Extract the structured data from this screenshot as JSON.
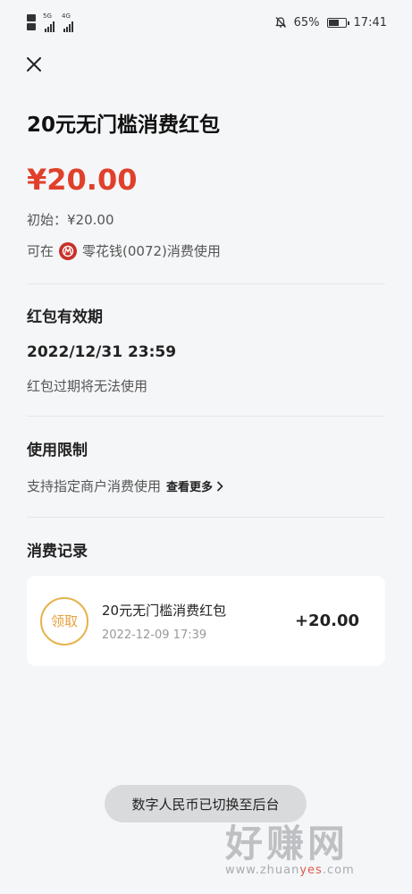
{
  "status_bar": {
    "sim1_type": "HD",
    "sim2_type": "HD",
    "net1": "5G",
    "net2": "4G",
    "battery": "65%",
    "battery_level": 0.65,
    "time": "17:41",
    "icons": [
      "hd-icon",
      "signal-icon",
      "mute-icon",
      "battery-icon"
    ]
  },
  "header": {
    "close_icon": "close-icon",
    "title": "20元无门槛消费红包"
  },
  "voucher": {
    "amount": "¥20.00",
    "initial": "初始：¥20.00",
    "usable_prefix": "可在",
    "merchant": "零花钱(0072)消费使用",
    "bank_logo_icon": "bank-logo-icon"
  },
  "validity": {
    "heading": "红包有效期",
    "date": "2022/12/31 23:59",
    "note": "红包过期将无法使用"
  },
  "usage_limit": {
    "heading": "使用限制",
    "text": "支持指定商户消费使用",
    "view_more": "查看更多"
  },
  "records": {
    "heading": "消费记录",
    "items": [
      {
        "badge": "领取",
        "name": "20元无门槛消费红包",
        "time": "2022-12-09 17:39",
        "amount": "+20.00"
      }
    ]
  },
  "toast": "数字人民币已切换至后台",
  "watermark": {
    "text": "好赚网",
    "url_prefix": "www.zhuan",
    "url_highlight": "yes",
    "url_suffix": ".com"
  },
  "colors": {
    "amount_red": "#e0402b",
    "badge_gold": "#e6a23c",
    "background": "#f5f6f8"
  }
}
